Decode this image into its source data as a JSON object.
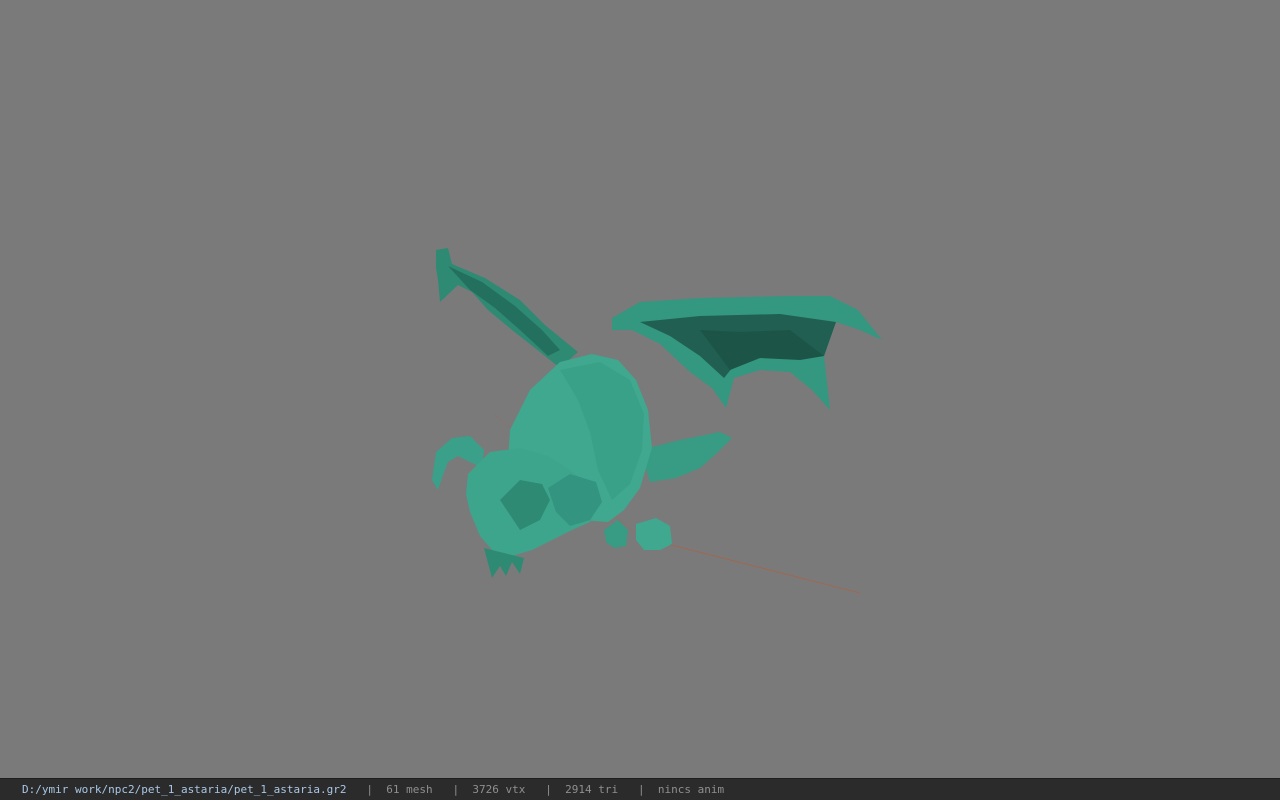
{
  "viewport": {
    "background": "#7a7a7a",
    "model_color": "#3a9f88",
    "model_shadow": "#24705f",
    "axis_color": "#a0522d"
  },
  "statusbar": {
    "file_path": "D:/ymir work/npc2/pet_1_astaria/pet_1_astaria.gr2",
    "separator": "|",
    "mesh": "61 mesh",
    "vtx": "3726 vtx",
    "tri": "2914 tri",
    "anim": "nincs anim"
  }
}
